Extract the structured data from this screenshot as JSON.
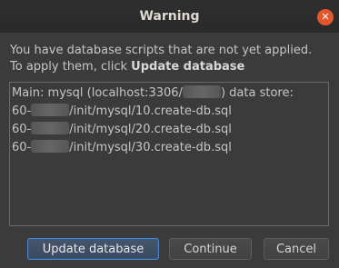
{
  "dialog": {
    "title": "Warning",
    "close_glyph": "✕",
    "message_line1": "You have database scripts that are not yet applied.",
    "message_line2_prefix": "To apply them, click ",
    "message_line2_bold": "Update database"
  },
  "scripts": {
    "header_prefix": "Main: mysql (localhost:3306/",
    "header_suffix": ") data store:",
    "lines": [
      {
        "prefix": "60-",
        "suffix": "/init/mysql/10.create-db.sql"
      },
      {
        "prefix": "60-",
        "suffix": "/init/mysql/20.create-db.sql"
      },
      {
        "prefix": "60-",
        "suffix": "/init/mysql/30.create-db.sql"
      }
    ]
  },
  "buttons": {
    "update": "Update database",
    "continue": "Continue",
    "cancel": "Cancel"
  },
  "colors": {
    "close_button": "#e2572b",
    "primary_border": "#4f86c6"
  }
}
